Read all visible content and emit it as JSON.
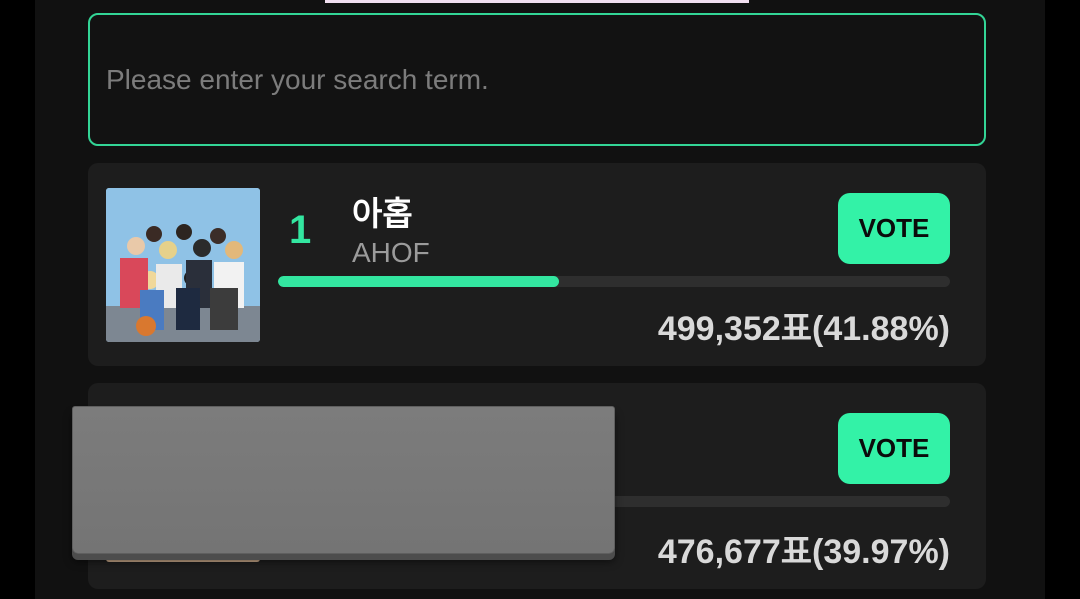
{
  "search": {
    "placeholder": "Please enter your search term.",
    "value": ""
  },
  "candidates": [
    {
      "rank": "1",
      "name": "아홉",
      "subname": "AHOF",
      "vote_label": "VOTE",
      "votes_text": "499,352표(41.88%)",
      "share_percent": 41.88
    },
    {
      "rank": "",
      "name": "",
      "subname": "",
      "vote_label": "VOTE",
      "votes_text": "476,677표(39.97%)",
      "share_percent": 39.97
    }
  ],
  "colors": {
    "accent": "#33e6a0",
    "vote_button": "#33f2a7",
    "card": "#1d1d1d",
    "background": "#111111"
  }
}
